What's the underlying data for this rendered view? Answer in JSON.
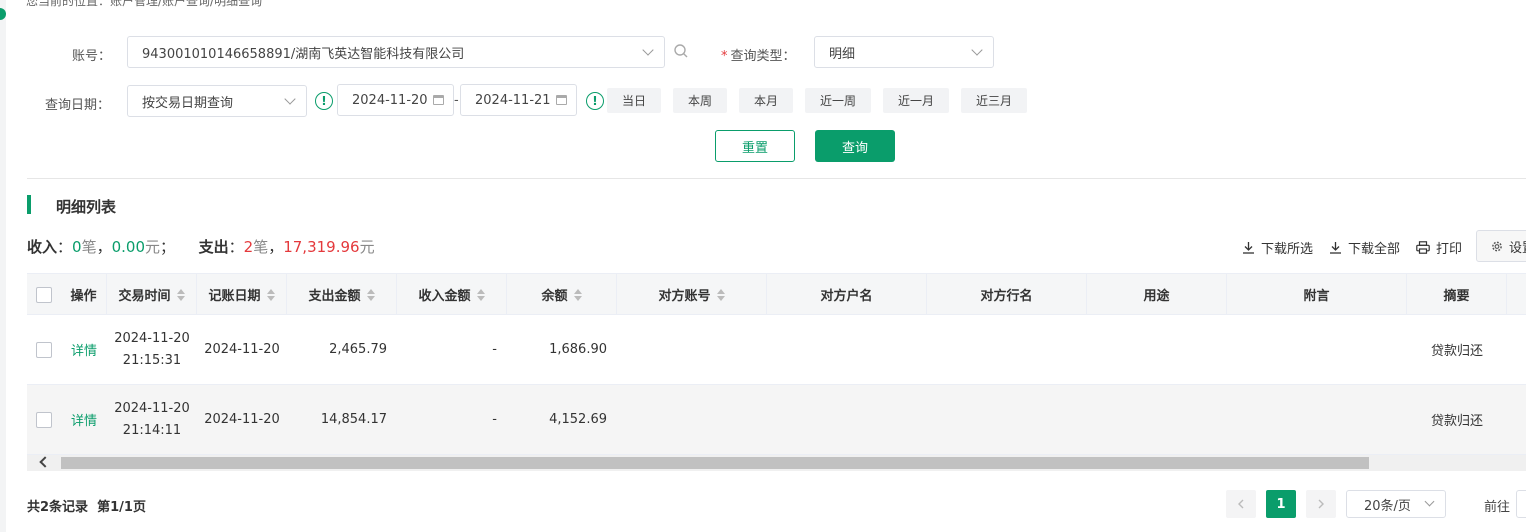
{
  "breadcrumb": "您当前的位置：账户管理/账户查询/明细查询",
  "filters": {
    "account_label": "账号：",
    "account_value": "943001010146658891/湖南飞英达智能科技有限公司",
    "query_type_label": "查询类型：",
    "query_type_required": "*",
    "query_type_value": "明细",
    "date_label": "查询日期：",
    "date_mode_value": "按交易日期查询",
    "start_date": "2024-11-20",
    "date_separator": "-",
    "end_date": "2024-11-21",
    "quick_ranges": [
      "当日",
      "本周",
      "本月",
      "近一周",
      "近一月",
      "近三月"
    ],
    "info_mark": "!"
  },
  "actions": {
    "reset": "重置",
    "query": "查询"
  },
  "section": {
    "title": "明细列表"
  },
  "summary": {
    "income_label": "收入",
    "colon": "：",
    "income_count": "0",
    "count_unit": "笔",
    "comma": "，",
    "income_amount": "0.00",
    "amount_unit": "元",
    "semicolon": "；",
    "expense_label": "支出",
    "expense_count": "2",
    "expense_amount": "17,319.96"
  },
  "toolbar": {
    "download_selected": "下载所选",
    "download_all": "下载全部",
    "print": "打印",
    "settings": "设置"
  },
  "table": {
    "columns": [
      "操作",
      "交易时间",
      "记账日期",
      "支出金额",
      "收入金额",
      "余额",
      "对方账号",
      "对方户名",
      "对方行名",
      "用途",
      "附言",
      "摘要"
    ],
    "rows": [
      {
        "action": "详情",
        "trade_date": "2024-11-20",
        "trade_time": "21:15:31",
        "book_date": "2024-11-20",
        "expense": "2,465.79",
        "income": "-",
        "balance": "1,686.90",
        "summary": "贷款归还"
      },
      {
        "action": "详情",
        "trade_date": "2024-11-20",
        "trade_time": "21:14:11",
        "book_date": "2024-11-20",
        "expense": "14,854.17",
        "income": "-",
        "balance": "4,152.69",
        "summary": "贷款归还"
      }
    ]
  },
  "pagination": {
    "total_text": "共2条记录",
    "page_text": "第1/1页",
    "current_page": "1",
    "page_size": "20条/页",
    "goto_label": "前往"
  },
  "colors": {
    "accent": "#0a9d6b",
    "negative": "#e4393c"
  }
}
